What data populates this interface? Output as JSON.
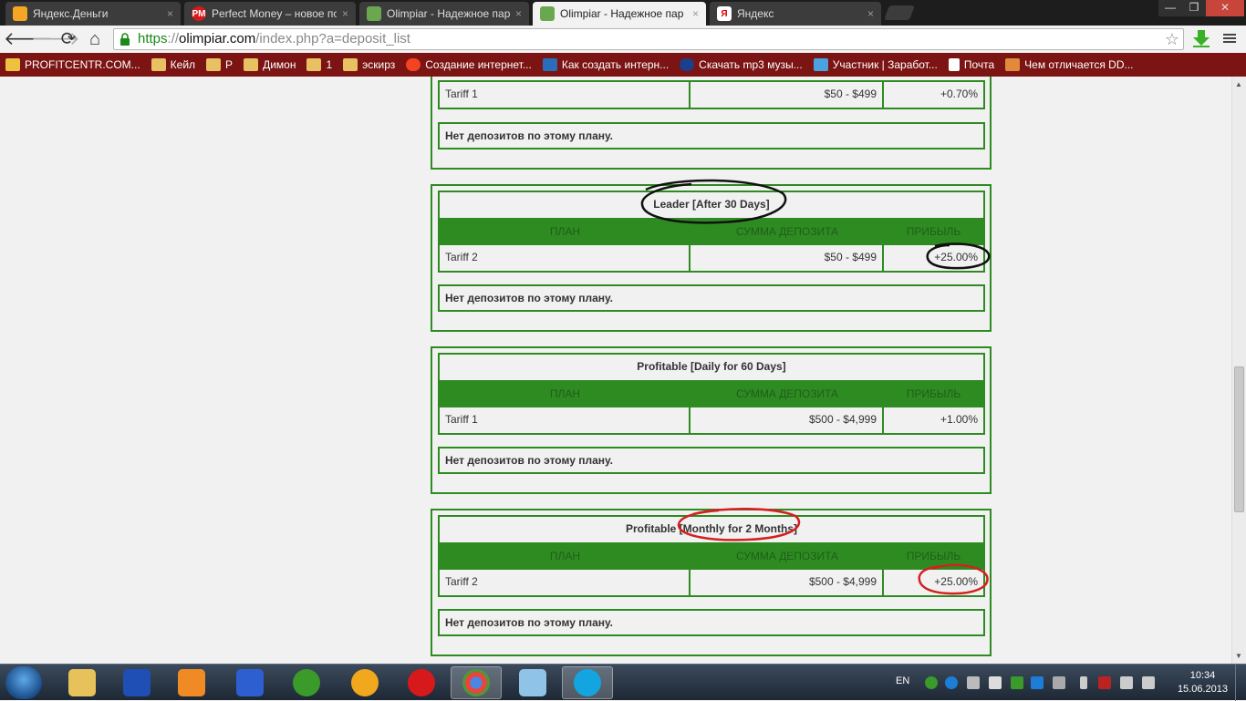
{
  "browser": {
    "tabs": [
      {
        "title": "Яндекс.Деньги",
        "favicon_color": "#f5a623",
        "favicon_glyph": "",
        "active": false
      },
      {
        "title": "Perfect Money – новое по",
        "favicon_color": "#d7191c",
        "favicon_glyph": "PM",
        "active": false
      },
      {
        "title": "Olimpiar - Надежное пар",
        "favicon_color": "#6aa84f",
        "favicon_glyph": "",
        "active": false
      },
      {
        "title": "Olimpiar - Надежное пар",
        "favicon_color": "#6aa84f",
        "favicon_glyph": "",
        "active": true
      },
      {
        "title": "Яндекс",
        "favicon_color": "#ffffff",
        "favicon_glyph": "Я",
        "active": false
      }
    ],
    "close_glyph": "×",
    "url": {
      "scheme": "https",
      "sep": "://",
      "host": "olimpiar.com",
      "path": "/index.php?a=deposit_list"
    },
    "star_glyph": "☆",
    "back_glyph": "🡐",
    "forward_glyph": "🡒",
    "reload_glyph": "⟳",
    "home_glyph": "⌂",
    "window_controls": {
      "minimize": "—",
      "maximize": "❐",
      "close": "✕"
    }
  },
  "bookmarks": [
    {
      "label": "PROFITCENTR.COM...",
      "icon": "bar-chart-icon",
      "color": "#f0c040"
    },
    {
      "label": "Кейл",
      "icon": "folder-icon",
      "color": "#e8c162"
    },
    {
      "label": "Р",
      "icon": "folder-icon",
      "color": "#e8c162"
    },
    {
      "label": "Димон",
      "icon": "folder-icon",
      "color": "#e8c162"
    },
    {
      "label": "1",
      "icon": "folder-icon",
      "color": "#e8c162"
    },
    {
      "label": "эскирз",
      "icon": "folder-icon",
      "color": "#e8c162"
    },
    {
      "label": "Создание интернет...",
      "icon": "joomla-icon",
      "color": "#f44321"
    },
    {
      "label": "Как создать интерн...",
      "icon": "e-icon",
      "color": "#2a6ebb"
    },
    {
      "label": "Скачать mp3 музы...",
      "icon": "globe-icon",
      "color": "#1c3f8c"
    },
    {
      "label": "Участник | Заработ...",
      "icon": "vk-like-icon",
      "color": "#4aa3df"
    },
    {
      "label": "Почта",
      "icon": "page-icon",
      "color": "#ffffff"
    },
    {
      "label": "Чем отличается DD...",
      "icon": "image-icon",
      "color": "#e08a3c"
    }
  ],
  "colors": {
    "accent": "#2e8b22",
    "header_text": "#1f5e19"
  },
  "plans": [
    {
      "title": "",
      "show_header": false,
      "row": {
        "plan": "Tariff 1",
        "amount": "$50 - $499",
        "profit": "+0.70%"
      },
      "no_deposits": "Нет депозитов по этому плану."
    },
    {
      "title": "Leader [After 30 Days]",
      "show_header": true,
      "row": {
        "plan": "Tariff 2",
        "amount": "$50 - $499",
        "profit": "+25.00%"
      },
      "no_deposits": "Нет депозитов по этому плану.",
      "annotation_color": "#111111"
    },
    {
      "title": "Profitable [Daily for 60 Days]",
      "show_header": true,
      "row": {
        "plan": "Tariff 1",
        "amount": "$500 - $4,999",
        "profit": "+1.00%"
      },
      "no_deposits": "Нет депозитов по этому плану."
    },
    {
      "title": "Profitable [Monthly for 2 Months]",
      "show_header": true,
      "row": {
        "plan": "Tariff 2",
        "amount": "$500 - $4,999",
        "profit": "+25.00%"
      },
      "no_deposits": "Нет депозитов по этому плану.",
      "annotation_color": "#d42020"
    }
  ],
  "table_headers": {
    "plan": "ПЛАН",
    "amount": "СУММА ДЕПОЗИТА",
    "profit": "ПРИБЫЛЬ"
  },
  "taskbar": {
    "apps": [
      {
        "name": "explorer-icon",
        "color": "#e7c15a",
        "active": false
      },
      {
        "name": "floppy-icon",
        "color": "#1f4fb5",
        "active": false
      },
      {
        "name": "media-player-icon",
        "color": "#f08a24",
        "active": false
      },
      {
        "name": "daum-potplayer-icon",
        "color": "#2e5fd1",
        "active": false
      },
      {
        "name": "utorrent-icon",
        "color": "#3a9a2a",
        "active": false
      },
      {
        "name": "aimp-icon",
        "color": "#f2a81d",
        "active": false
      },
      {
        "name": "opera-icon",
        "color": "#d7191c",
        "active": false
      },
      {
        "name": "chrome-icon",
        "color": "#4a9a3a",
        "active": true
      },
      {
        "name": "notepad-icon",
        "color": "#8fc4e8",
        "active": false
      },
      {
        "name": "skype-icon",
        "color": "#14a4e0",
        "active": false
      }
    ],
    "language": "EN",
    "time": "10:34",
    "date": "15.06.2013"
  }
}
